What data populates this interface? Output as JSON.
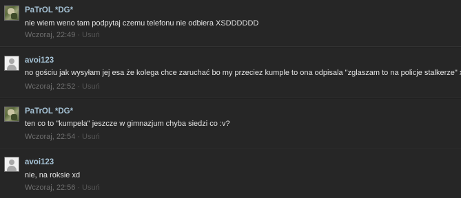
{
  "messages": [
    {
      "author": "PaTrOL *DG*",
      "avatar": "user-photo-avatar",
      "text": "nie wiem weno tam podpytaj czemu telefonu nie odbiera XSDDDDDD",
      "time": "Wczoraj, 22:49",
      "separator": "·",
      "delete_label": "Usuń"
    },
    {
      "author": "avoi123",
      "avatar": "default-user-avatar",
      "text": "no gościu jak wysyłam jej esa że kolega chce zaruchać bo my przeciez kumple to ona odpisala \"zglaszam to na policje stalkerze\" xD",
      "time": "Wczoraj, 22:52",
      "separator": "·",
      "delete_label": "Usuń"
    },
    {
      "author": "PaTrOL *DG*",
      "avatar": "user-photo-avatar",
      "text": "ten co to \"kumpela\" jeszcze w gimnazjum chyba siedzi co :v?",
      "time": "Wczoraj, 22:54",
      "separator": "·",
      "delete_label": "Usuń"
    },
    {
      "author": "avoi123",
      "avatar": "default-user-avatar",
      "text": "nie, na roksie xd",
      "time": "Wczoraj, 22:56",
      "separator": "·",
      "delete_label": "Usuń"
    }
  ],
  "colors": {
    "background": "#262626",
    "author": "#a6c3d6",
    "text": "#e6e6e6",
    "meta": "#6e6e6e",
    "divider": "#333333"
  }
}
